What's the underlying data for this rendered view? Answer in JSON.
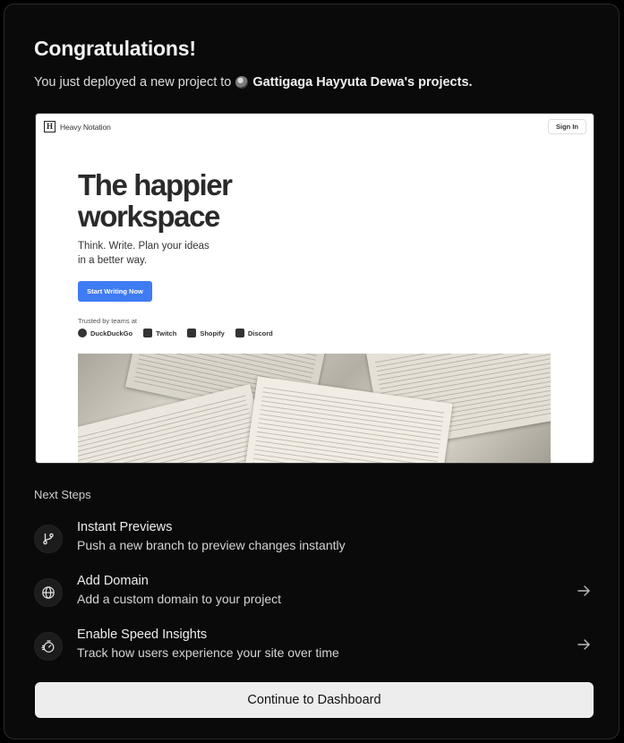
{
  "title": "Congratulations!",
  "subtitle": {
    "prefix": "You just deployed a new project to",
    "owner": "Gattigaga Hayyuta Dewa's projects."
  },
  "preview": {
    "brand": "Heavy Notation",
    "logo_letter": "H",
    "sign_in": "Sign In",
    "hero_line1": "The happier",
    "hero_line2": "workspace",
    "description_line1": "Think. Write. Plan your ideas",
    "description_line2": "in a better way.",
    "cta": "Start Writing Now",
    "trusted": "Trusted by teams at",
    "logos": [
      "DuckDuckGo",
      "Twitch",
      "Shopify",
      "Discord"
    ]
  },
  "next_steps_label": "Next Steps",
  "steps": [
    {
      "title": "Instant Previews",
      "description": "Push a new branch to preview changes instantly",
      "icon": "git-branch-icon"
    },
    {
      "title": "Add Domain",
      "description": "Add a custom domain to your project",
      "icon": "globe-icon"
    },
    {
      "title": "Enable Speed Insights",
      "description": "Track how users experience your site over time",
      "icon": "speed-insights-icon"
    }
  ],
  "continue_button": "Continue to Dashboard"
}
